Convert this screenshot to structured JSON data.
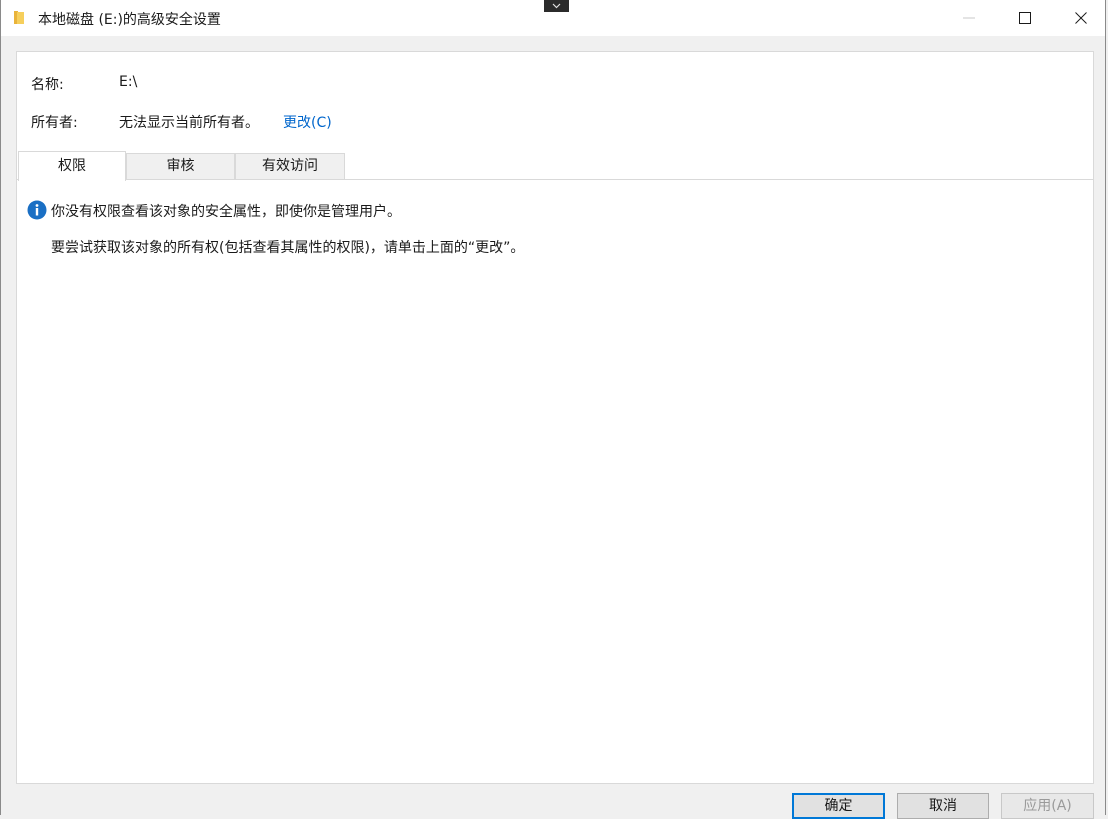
{
  "window": {
    "title": "本地磁盘 (E:)的高级安全设置",
    "folder_color": "#f0c24c"
  },
  "fields": {
    "name_label": "名称:",
    "name_value": "E:\\",
    "owner_label": "所有者:",
    "owner_value": "无法显示当前所有者。",
    "change_link": "更改(C)"
  },
  "tabs": [
    {
      "label": "权限",
      "active": true
    },
    {
      "label": "审核",
      "active": false
    },
    {
      "label": "有效访问",
      "active": false
    }
  ],
  "messages": {
    "info": "你没有权限查看该对象的安全属性，即使你是管理用户。",
    "hint": "要尝试获取该对象的所有权(包括查看其属性的权限)，请单击上面的“更改”。"
  },
  "buttons": {
    "ok": "确定",
    "cancel": "取消",
    "apply": "应用(A)"
  },
  "colors": {
    "accent": "#0078d7",
    "link": "#0066cc",
    "info_icon": "#1a6fc4"
  }
}
